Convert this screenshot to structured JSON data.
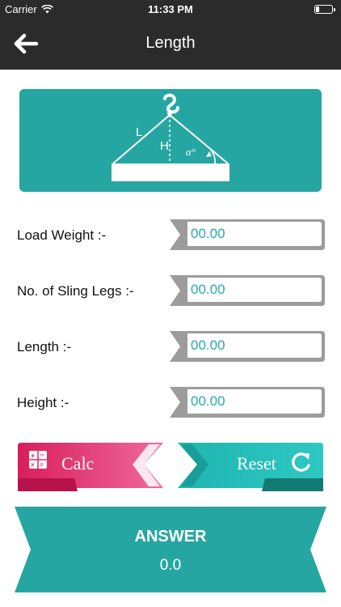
{
  "status_bar": {
    "carrier": "Carrier",
    "time": "11:33 PM",
    "battery_level": 0.2
  },
  "header": {
    "title": "Length",
    "back_icon": "arrow-left-icon"
  },
  "diagram": {
    "labels": {
      "length": "L",
      "height": "H",
      "angle": "α°"
    },
    "icon": "crane-hook-icon"
  },
  "form": {
    "fields": [
      {
        "label": "Load Weight :-",
        "placeholder": "00.00"
      },
      {
        "label": "No. of Sling Legs :-",
        "placeholder": "00.00"
      },
      {
        "label": "Length :-",
        "placeholder": "00.00"
      },
      {
        "label": "Height :-",
        "placeholder": "00.00"
      }
    ]
  },
  "buttons": {
    "calc_label": "Calc",
    "reset_label": "Reset",
    "calc_icon": "calculator-icon",
    "reset_icon": "refresh-icon"
  },
  "answer": {
    "title": "ANSWER",
    "value": "0.0"
  },
  "colors": {
    "teal": "#26a6a2",
    "pink": "#e0306a",
    "dark": "#2b2b2b",
    "input_text": "#2aa8b5"
  }
}
